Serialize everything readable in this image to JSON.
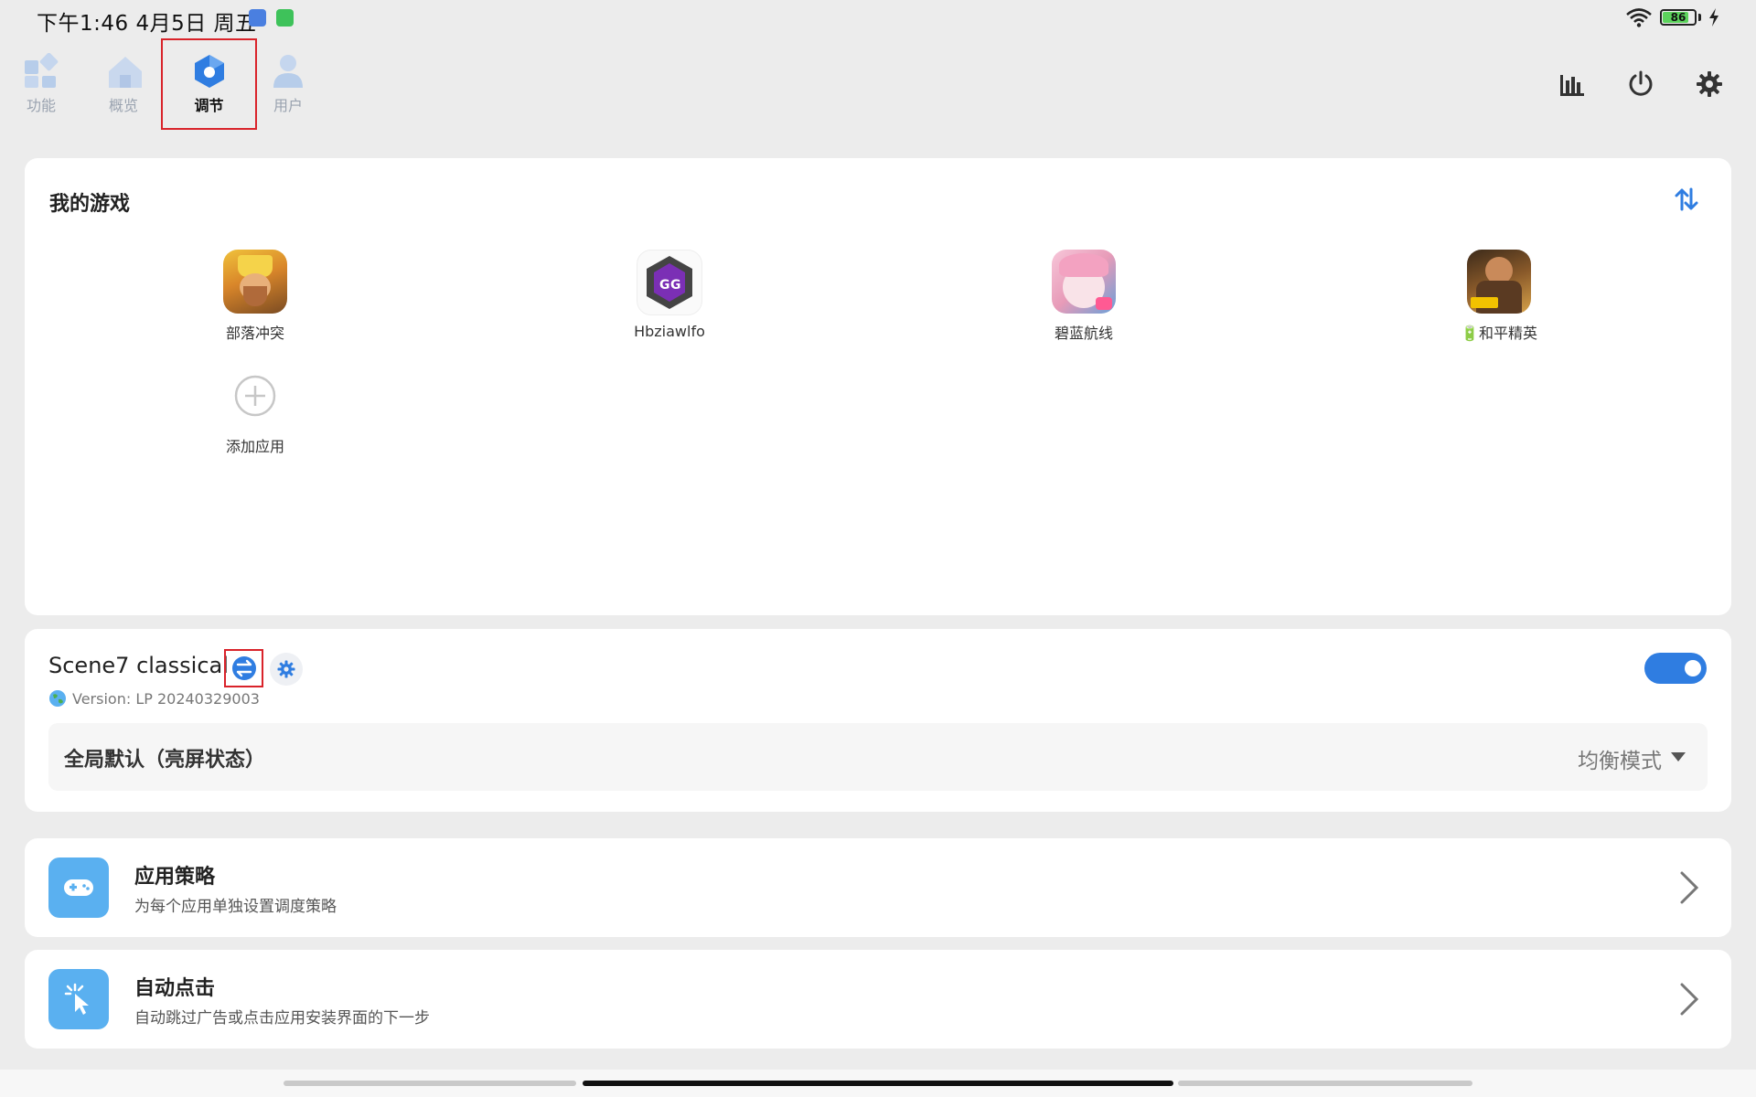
{
  "status_bar": {
    "time_text": "下午1:46 4月5日 周五",
    "battery_percent": 86,
    "battery_label": "86",
    "wifi_icon": "wifi-icon",
    "charging_icon": "bolt-icon"
  },
  "nav": {
    "tabs": [
      {
        "label": "功能",
        "icon": "grid-icon"
      },
      {
        "label": "概览",
        "icon": "home-icon"
      },
      {
        "label": "调节",
        "icon": "hexagon-icon",
        "active": true
      },
      {
        "label": "用户",
        "icon": "user-icon"
      }
    ],
    "actions": [
      "bar-chart-icon",
      "power-icon",
      "gear-icon"
    ]
  },
  "games_card": {
    "title": "我的游戏",
    "sort_icon": "sort-icon",
    "games": [
      {
        "label": "部落冲突"
      },
      {
        "label": "Hbziawlfo"
      },
      {
        "label": "碧蓝航线"
      },
      {
        "label": "🔋和平精英"
      }
    ],
    "add_label": "添加应用"
  },
  "scene_card": {
    "title": "Scene7 classical",
    "version": "Version: LP 20240329003",
    "enabled": true,
    "mode_label": "全局默认（亮屏状态）",
    "mode_value": "均衡模式"
  },
  "list_items": [
    {
      "title": "应用策略",
      "subtitle": "为每个应用单独设置调度策略",
      "icon": "gamepad-icon"
    },
    {
      "title": "自动点击",
      "subtitle": "自动跳过广告或点击应用安装界面的下一步",
      "icon": "tap-icon"
    }
  ],
  "colors": {
    "accent": "#2f7de1",
    "highlight_box": "#d9232a",
    "list_icon_bg": "#5ab0f0"
  }
}
